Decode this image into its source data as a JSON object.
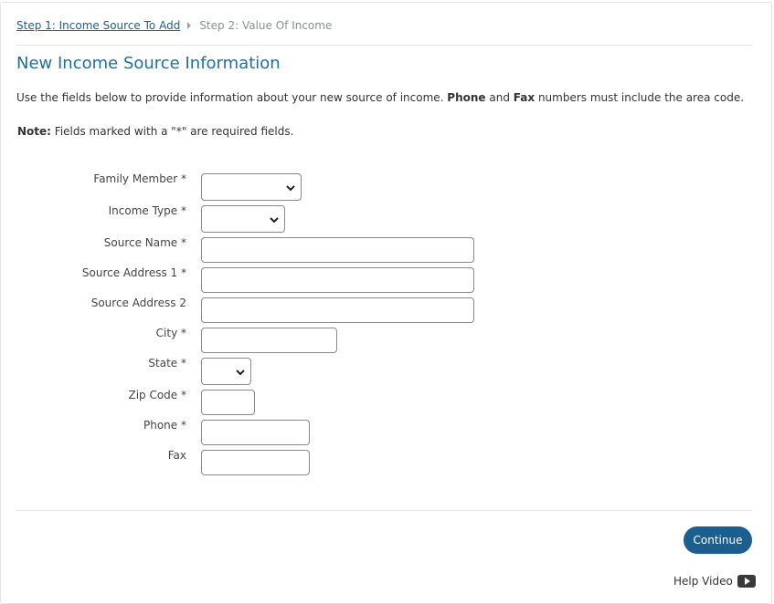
{
  "breadcrumb": {
    "step1": "Step 1: Income Source To Add",
    "step2": "Step 2: Value Of Income"
  },
  "page_title": "New Income Source Information",
  "intro": {
    "part1": "Use the fields below to provide information about your new source of income. ",
    "phone": "Phone",
    "and": " and ",
    "fax": "Fax",
    "part2": " numbers must include the area code."
  },
  "note": {
    "label": "Note:",
    "text": " Fields marked with a \"*\" are required fields."
  },
  "form": {
    "family_member_label": "Family Member *",
    "income_type_label": "Income Type *",
    "source_name_label": "Source Name *",
    "source_address1_label": "Source Address 1 *",
    "source_address2_label": "Source Address 2",
    "city_label": "City *",
    "state_label": "State *",
    "zip_label": "Zip Code *",
    "phone_label": "Phone *",
    "fax_label": "Fax",
    "family_member_value": "",
    "income_type_value": "",
    "source_name_value": "",
    "source_address1_value": "",
    "source_address2_value": "",
    "city_value": "",
    "state_value": "",
    "zip_value": "",
    "phone_value": "",
    "fax_value": ""
  },
  "continue_label": "Continue",
  "help_label": "Help Video",
  "colors": {
    "accent": "#1c5f8e",
    "title": "#1f6f9a",
    "link": "#1f5f8b"
  }
}
